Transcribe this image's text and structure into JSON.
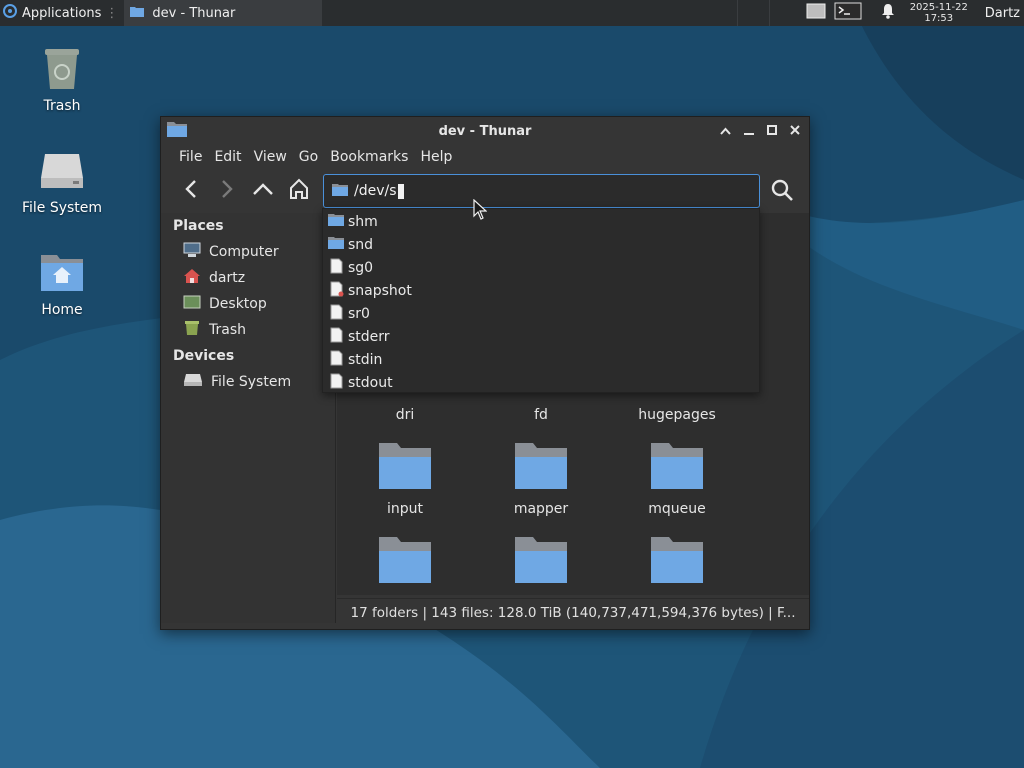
{
  "panel": {
    "applications_label": "Applications",
    "task_title": "dev - Thunar",
    "clock_date": "2025-11-22",
    "clock_time": "17:53",
    "user": "Dartz"
  },
  "desktop": {
    "icons": [
      {
        "label": "Trash",
        "icon": "trash-icon"
      },
      {
        "label": "File System",
        "icon": "drive-icon"
      },
      {
        "label": "Home",
        "icon": "home-folder-icon"
      }
    ]
  },
  "window": {
    "title": "dev - Thunar",
    "menu": [
      "File",
      "Edit",
      "View",
      "Go",
      "Bookmarks",
      "Help"
    ],
    "location_value": "/dev/s",
    "sidebar": {
      "places_heading": "Places",
      "places": [
        {
          "label": "Computer",
          "icon": "computer-icon"
        },
        {
          "label": "dartz",
          "icon": "user-home-icon"
        },
        {
          "label": "Desktop",
          "icon": "desktop-icon"
        },
        {
          "label": "Trash",
          "icon": "trash-icon"
        }
      ],
      "devices_heading": "Devices",
      "devices": [
        {
          "label": "File System",
          "icon": "drive-icon"
        }
      ]
    },
    "files": [
      "dri",
      "fd",
      "hugepages",
      "input",
      "mapper",
      "mqueue",
      "",
      "",
      ""
    ],
    "status": "17 folders  |  143 files: 128.0 TiB (140,737,471,594,376 bytes)  |  F..."
  },
  "completion": {
    "items": [
      {
        "label": "shm",
        "icon": "folder-icon"
      },
      {
        "label": "snd",
        "icon": "folder-icon"
      },
      {
        "label": "sg0",
        "icon": "file-icon"
      },
      {
        "label": "snapshot",
        "icon": "file-icon"
      },
      {
        "label": "sr0",
        "icon": "file-icon"
      },
      {
        "label": "stderr",
        "icon": "file-icon"
      },
      {
        "label": "stdin",
        "icon": "file-icon"
      },
      {
        "label": "stdout",
        "icon": "file-icon"
      }
    ]
  },
  "colors": {
    "panel_bg": "#2a2d2f",
    "window_bg": "#353535",
    "accent": "#4a90d9",
    "folder_blue": "#6fa8e4",
    "wallpaper_dark": "#1a4a6b",
    "wallpaper_light": "#2b6a93"
  }
}
